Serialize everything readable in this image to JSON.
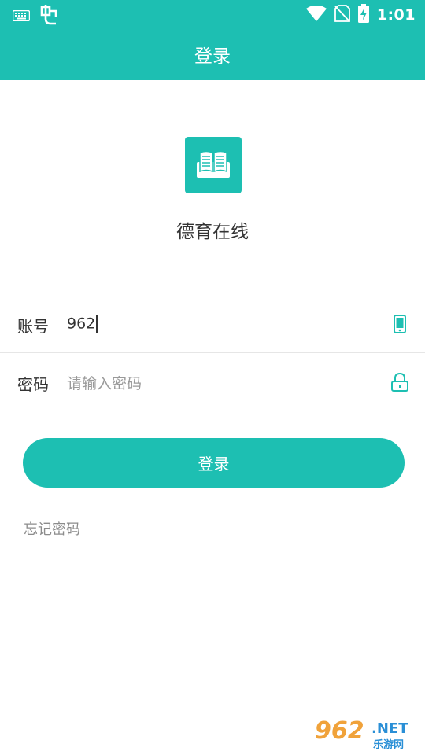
{
  "colors": {
    "accent": "#1dbfb2",
    "text_primary": "#333333",
    "placeholder": "#9a9a9a",
    "divider": "#e6e6e6"
  },
  "status_bar": {
    "time": "1:01",
    "icons": [
      "keyboard-icon",
      "bug-icon",
      "wifi-icon",
      "no-sim-icon",
      "battery-charging-icon"
    ]
  },
  "header": {
    "title": "登录"
  },
  "brand": {
    "logo_icon": "open-book-icon",
    "app_name": "德育在线"
  },
  "form": {
    "account": {
      "label": "账号",
      "value": "962",
      "icon": "phone-icon"
    },
    "password": {
      "label": "密码",
      "placeholder": "请输入密码",
      "icon": "lock-icon"
    },
    "submit_label": "登录",
    "forgot_password": "忘记密码"
  },
  "watermark": {
    "main": "962",
    "suffix": ".NET",
    "sub": "乐游网"
  }
}
